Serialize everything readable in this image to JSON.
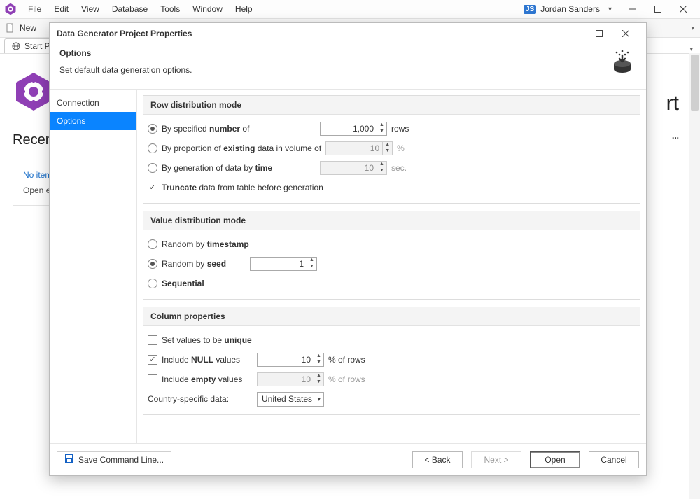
{
  "menu": {
    "items": [
      "File",
      "Edit",
      "View",
      "Database",
      "Tools",
      "Window",
      "Help"
    ]
  },
  "user": {
    "badge": "JS",
    "name": "Jordan Sanders"
  },
  "toolstrip": {
    "new": "New"
  },
  "tab": {
    "start": "Start Page"
  },
  "bg": {
    "recent_title": "Recent",
    "recent_none": "No items to show",
    "recent_tip": "Open existing file or create a new one to start using dbForge Schema Compare",
    "rt": "rt",
    "opts": "..."
  },
  "dialog": {
    "title": "Data Generator Project Properties",
    "header": {
      "title": "Options",
      "subtitle": "Set default data generation options."
    },
    "nav": [
      "Connection",
      "Options"
    ],
    "nav_active": 1,
    "groups": {
      "row": {
        "title": "Row distribution mode",
        "by_number_pre": "By specified ",
        "by_number_b": "number",
        "by_number_post": " of",
        "by_number_val": "1,000",
        "by_number_unit": "rows",
        "by_prop_pre": "By proportion of ",
        "by_prop_b": "existing",
        "by_prop_post": " data in volume of",
        "by_prop_val": "10",
        "by_prop_unit": "%",
        "by_time_pre": "By generation of data by ",
        "by_time_b": "time",
        "by_time_val": "10",
        "by_time_unit": "sec.",
        "truncate_b": "Truncate",
        "truncate_post": " data from table before generation"
      },
      "val": {
        "title": "Value distribution mode",
        "ts_pre": "Random by ",
        "ts_b": "timestamp",
        "seed_pre": "Random by ",
        "seed_b": "seed",
        "seed_val": "1",
        "seq_b": "Sequential"
      },
      "col": {
        "title": "Column properties",
        "unique_pre": "Set values to be ",
        "unique_b": "unique",
        "null_pre": "Include ",
        "null_b": "NULL",
        "null_post": " values",
        "null_val": "10",
        "null_unit": "% of rows",
        "empty_pre": "Include ",
        "empty_b": "empty",
        "empty_post": " values",
        "empty_val": "10",
        "empty_unit": "% of rows",
        "country_label": "Country-specific data:",
        "country_value": "United States"
      }
    },
    "footer": {
      "save": "Save Command Line...",
      "back": "< Back",
      "next": "Next >",
      "open": "Open",
      "cancel": "Cancel"
    }
  }
}
